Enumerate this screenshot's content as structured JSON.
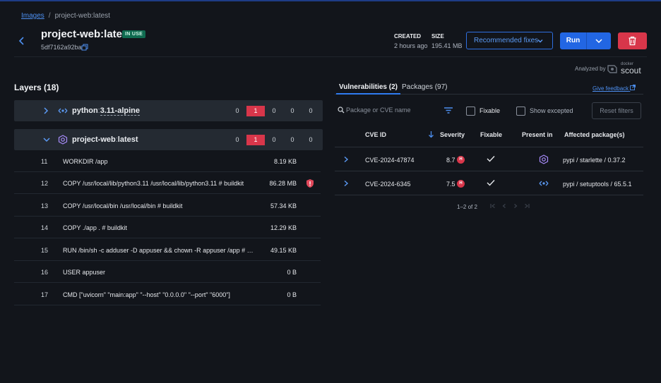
{
  "breadcrumb": {
    "link": "Images",
    "separator": "/",
    "current": "project-web:latest"
  },
  "image": {
    "title": "project-web:latest",
    "badge": "IN USE",
    "digest": "5df7162a92ba"
  },
  "meta": {
    "created_label": "CREATED",
    "created_value": "2 hours ago",
    "size_label": "SIZE",
    "size_value": "195.41 MB"
  },
  "actions": {
    "recommended_fixes": "Recommended fixes",
    "run": "Run"
  },
  "analyzed": {
    "label": "Analyzed by",
    "logo_small": "docker",
    "logo_big": "scout"
  },
  "layers": {
    "title": "Layers (18)",
    "groups": [
      {
        "prefix": "python",
        "colon": ":",
        "tag": "3.11-alpine",
        "counts": [
          "0",
          "1",
          "0",
          "0",
          "0"
        ],
        "icon": "alpine-base-icon"
      },
      {
        "prefix": "project-web",
        "colon": ":",
        "tag": "latest",
        "counts": [
          "0",
          "1",
          "0",
          "0",
          "0"
        ],
        "icon": "image-hex-icon"
      }
    ],
    "rows": [
      {
        "n": "11",
        "cmd": "WORKDIR /app",
        "size": "8.19 KB",
        "flag": false
      },
      {
        "n": "12",
        "cmd": "COPY /usr/local/lib/python3.11 /usr/local/lib/python3.11 # buildkit",
        "size": "86.28 MB",
        "flag": true
      },
      {
        "n": "13",
        "cmd": "COPY /usr/local/bin /usr/local/bin # buildkit",
        "size": "57.34 KB",
        "flag": false
      },
      {
        "n": "14",
        "cmd": "COPY ./app . # buildkit",
        "size": "12.29 KB",
        "flag": false
      },
      {
        "n": "15",
        "cmd": "RUN /bin/sh -c adduser -D appuser && chown -R appuser /app # buildkit",
        "size": "49.15 KB",
        "flag": false
      },
      {
        "n": "16",
        "cmd": "USER appuser",
        "size": "0 B",
        "flag": false
      },
      {
        "n": "17",
        "cmd": "CMD [\"uvicorn\" \"main:app\" \"--host\" \"0.0.0.0\" \"--port\" \"6000\"]",
        "size": "0 B",
        "flag": false
      }
    ]
  },
  "tabs": {
    "vulnerabilities": "Vulnerabilities (2)",
    "packages": "Packages (97)"
  },
  "feedback": "Give feedback",
  "filters": {
    "search_placeholder": "Package or CVE name",
    "fixable": "Fixable",
    "show_excepted": "Show excepted",
    "reset": "Reset filters"
  },
  "table": {
    "headers": {
      "cve": "CVE ID",
      "severity": "Severity",
      "fixable": "Fixable",
      "present": "Present in",
      "affected": "Affected package(s)"
    },
    "rows": [
      {
        "cve": "CVE-2024-47874",
        "score": "8.7",
        "sev": "H",
        "present_icon": "image-hex-icon",
        "pkg": "pypi / starlette / 0.37.2"
      },
      {
        "cve": "CVE-2024-6345",
        "score": "7.5",
        "sev": "H",
        "present_icon": "alpine-base-icon",
        "pkg": "pypi / setuptools / 65.5.1"
      }
    ]
  },
  "pagination": {
    "text": "1–2 of 2"
  },
  "colors": {
    "accent": "#2266e3",
    "critical": "#d8364a",
    "badge": "#0f6b50",
    "background": "#12151b"
  }
}
